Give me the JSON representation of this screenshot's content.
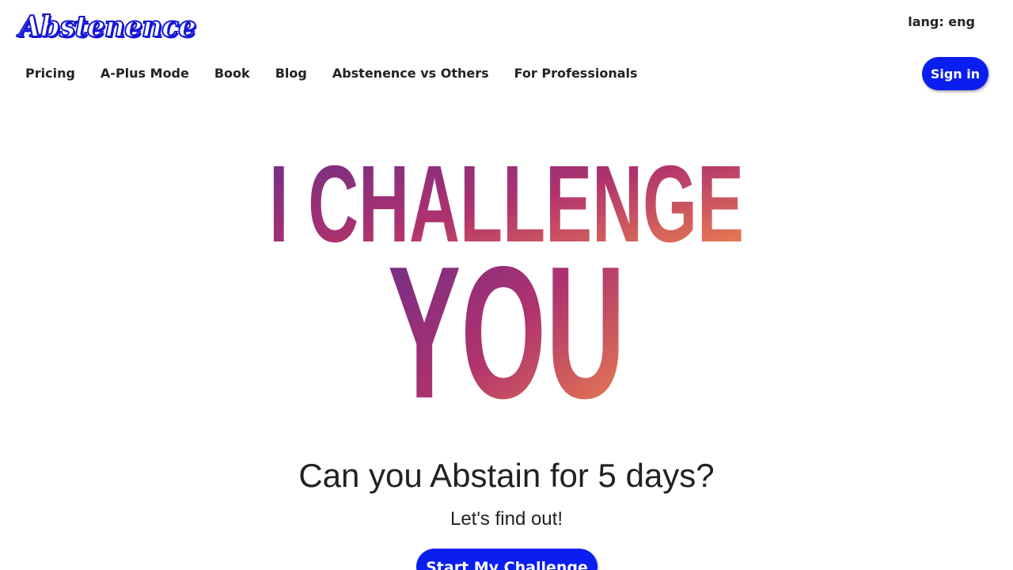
{
  "header": {
    "logo_text": "Abstenence",
    "lang_label": "lang: eng",
    "sign_in_label": "Sign in"
  },
  "nav": {
    "items": [
      {
        "label": "Pricing"
      },
      {
        "label": "A-Plus Mode"
      },
      {
        "label": "Book"
      },
      {
        "label": "Blog"
      },
      {
        "label": "Abstenence vs Others"
      },
      {
        "label": "For Professionals"
      }
    ]
  },
  "hero": {
    "line1": "I CHALLENGE",
    "line2": "YOU",
    "gradient_colors": [
      "#6b2d8a",
      "#b0326e",
      "#f08a4b"
    ],
    "headline": "Can you Abstain for 5 days?",
    "subline": "Let's find out!",
    "cta_label": "Start My Challenge"
  },
  "colors": {
    "accent": "#0a1ef0",
    "text": "#222222"
  }
}
